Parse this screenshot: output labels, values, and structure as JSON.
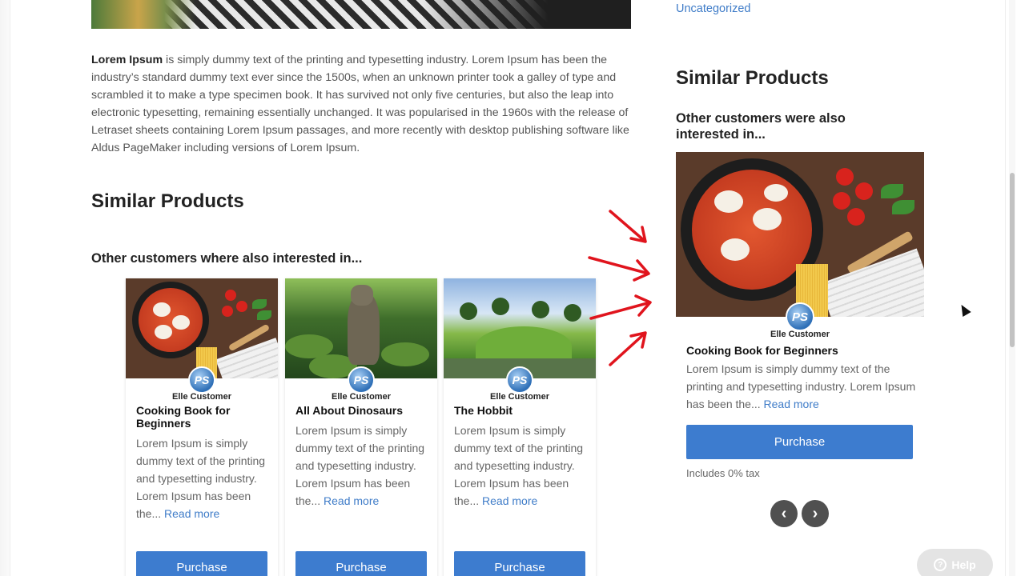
{
  "main": {
    "intro_bold": "Lorem Ipsum",
    "intro_text": " is simply dummy text of the printing and typesetting industry. Lorem Ipsum has been the industry’s standard dummy text ever since the 1500s, when an unknown printer took a galley of type and scrambled it to make a type specimen book. It has survived not only five centuries, but also the leap into electronic typesetting, remaining essentially unchanged. It was popularised in the 1960s with the release of Letraset sheets containing Lorem Ipsum passages, and more recently with desktop publishing software like Aldus PageMaker including versions of Lorem Ipsum.",
    "similar_heading": "Similar Products",
    "other_heading": "Other customers where also interested in...",
    "products": [
      {
        "author": "Elle Customer",
        "title": "Cooking Book for Beginners",
        "desc": "Lorem Ipsum is simply dummy text of the printing and typesetting industry. Lorem Ipsum has been the...",
        "read_more": "Read more",
        "buy": "Purchase",
        "badge": "PS"
      },
      {
        "author": "Elle Customer",
        "title": "All About Dinosaurs",
        "desc": "Lorem Ipsum is simply dummy text of the printing and typesetting industry. Lorem Ipsum has been the...",
        "read_more": "Read more",
        "buy": "Purchase",
        "badge": "PS"
      },
      {
        "author": "Elle Customer",
        "title": "The Hobbit",
        "desc": "Lorem Ipsum is simply dummy text of the printing and typesetting industry. Lorem Ipsum has been the...",
        "read_more": "Read more",
        "buy": "Purchase",
        "badge": "PS"
      }
    ]
  },
  "sidebar": {
    "category_link": "Uncategorized",
    "similar_heading": "Similar Products",
    "other_heading": "Other customers were also interested in...",
    "product": {
      "author": "Elle Customer",
      "title": "Cooking Book for Beginners",
      "desc": "Lorem Ipsum is simply dummy text of the printing and typesetting industry. Lorem Ipsum has been the...",
      "read_more": "Read more",
      "buy": "Purchase",
      "tax": "Includes 0% tax",
      "badge": "PS"
    },
    "prev_icon": "‹",
    "next_icon": "›"
  },
  "help_button": "Help",
  "help_icon": "?",
  "colors": {
    "accent": "#3d7ccf",
    "link": "#3f7cc8",
    "arrow": "#e0141d"
  }
}
